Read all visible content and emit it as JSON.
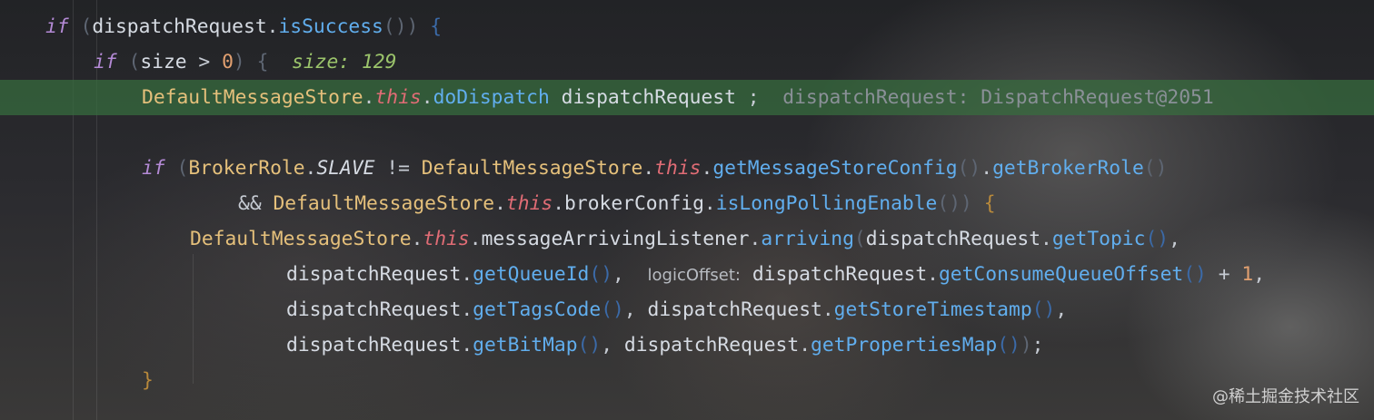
{
  "code": {
    "line1": {
      "kw": "if",
      "p1": " (",
      "id1": "dispatchRequest",
      ".": ".",
      "fn1": "isSuccess",
      "p2": "()",
      "p3": ") ",
      "brace": "{"
    },
    "line2": {
      "kw": "if",
      "p1": " (",
      "id1": "size",
      "op": " > ",
      "num": "0",
      "p2": ") ",
      "brace": "{",
      "hint_label": "  size: ",
      "hint_value": "129"
    },
    "line3": {
      "cls": "DefaultMessageStore",
      "dot1": ".",
      "this": "this",
      "dot2": ".",
      "fn": "doDispatch",
      "sp": " ",
      "arg": "dispatchRequest",
      "semi": " ;",
      "hint": "  dispatchRequest: DispatchRequest@2051"
    },
    "line5": {
      "kw": "if",
      "p1": " (",
      "cls1": "BrokerRole",
      "dot1": ".",
      "const": "SLAVE",
      "op": " != ",
      "cls2": "DefaultMessageStore",
      "dot2": ".",
      "this": "this",
      "dot3": ".",
      "fn1": "getMessageStoreConfig",
      "p2": "()",
      "dot4": ".",
      "fn2": "getBrokerRole",
      "p3": "()"
    },
    "line6": {
      "op": "&& ",
      "cls": "DefaultMessageStore",
      "dot1": ".",
      "this": "this",
      "dot2": ".",
      "id": "brokerConfig",
      "dot3": ".",
      "fn": "isLongPollingEnable",
      "p1": "()",
      "p2": ") ",
      "brace": "{"
    },
    "line7": {
      "cls": "DefaultMessageStore",
      "dot1": ".",
      "this": "this",
      "dot2": ".",
      "id": "messageArrivingListener",
      "dot3": ".",
      "fn1": "arriving",
      "p1": "(",
      "arg": "dispatchRequest",
      "dot4": ".",
      "fn2": "getTopic",
      "p2": "()",
      "comma": ","
    },
    "line8": {
      "arg1": "dispatchRequest",
      "dot1": ".",
      "fn1": "getQueueId",
      "p1": "()",
      "comma1": ",  ",
      "hint": "logicOffset:",
      "sp": " ",
      "arg2": "dispatchRequest",
      "dot2": ".",
      "fn2": "getConsumeQueueOffset",
      "p2": "()",
      "op": " + ",
      "num": "1",
      "comma2": ","
    },
    "line9": {
      "arg1": "dispatchRequest",
      "dot1": ".",
      "fn1": "getTagsCode",
      "p1": "()",
      "comma1": ", ",
      "arg2": "dispatchRequest",
      "dot2": ".",
      "fn2": "getStoreTimestamp",
      "p2": "()",
      "comma2": ","
    },
    "line10": {
      "arg1": "dispatchRequest",
      "dot1": ".",
      "fn1": "getBitMap",
      "p1": "()",
      "comma1": ", ",
      "arg2": "dispatchRequest",
      "dot2": ".",
      "fn2": "getPropertiesMap",
      "p2": "()",
      "p3": ")",
      "semi": ";"
    },
    "line11": {
      "brace": "}"
    }
  },
  "watermark": "@稀土掘金技术社区",
  "colors": {
    "execution_line": "#386e3e",
    "keyword": "#b48ad6",
    "method": "#61aeee",
    "class": "#e5c07b",
    "this": "#e06c75",
    "number": "#e2a070",
    "inlay_value": "#9bc46b"
  }
}
